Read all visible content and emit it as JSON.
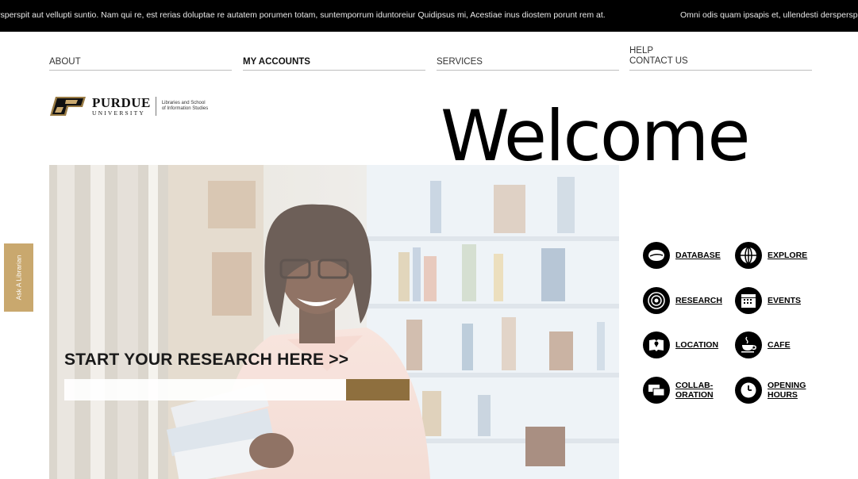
{
  "ticker": {
    "text_1": "rsperspit aut vellupti suntio. Nam qui re, est rerias doluptae re autatem porumen totam, suntemporrum iduntoreiur Quidipsus mi, Acestiae inus diostem porunt rem at.",
    "text_2": "Omni odis quam ipsapis et, ullendesti dersperspit"
  },
  "nav": {
    "about": "ABOUT",
    "my_accounts": "MY ACCOUNTS",
    "services": "SERVICES",
    "help": "HELP",
    "contact_us": "CONTACT US"
  },
  "logo": {
    "wordmark": "PURDUE",
    "university": "UNIVERSITY",
    "subtitle_line1": "Libraries and School",
    "subtitle_line2": "of Information Studies"
  },
  "welcome": "Welcome",
  "hero": {
    "cta": "START YOUR RESEARCH HERE >>",
    "search_value": "",
    "search_placeholder": "",
    "button_color": "#8e6f3e"
  },
  "side_tab": {
    "label": "Ask A Librarian",
    "color": "#c9a86e"
  },
  "quick_links": [
    {
      "label": "DATABASE",
      "icon": "database-icon"
    },
    {
      "label": "EXPLORE",
      "icon": "globe-icon"
    },
    {
      "label": "RESEARCH",
      "icon": "target-icon"
    },
    {
      "label": "EVENTS",
      "icon": "calendar-icon"
    },
    {
      "label": "LOCATION",
      "icon": "map-book-icon"
    },
    {
      "label": "CAFE",
      "icon": "coffee-cup-icon"
    },
    {
      "label": "COLLAB-\nORATION",
      "icon": "chat-bubbles-icon"
    },
    {
      "label": "OPENING\nHOURS",
      "icon": "clock-icon"
    }
  ]
}
